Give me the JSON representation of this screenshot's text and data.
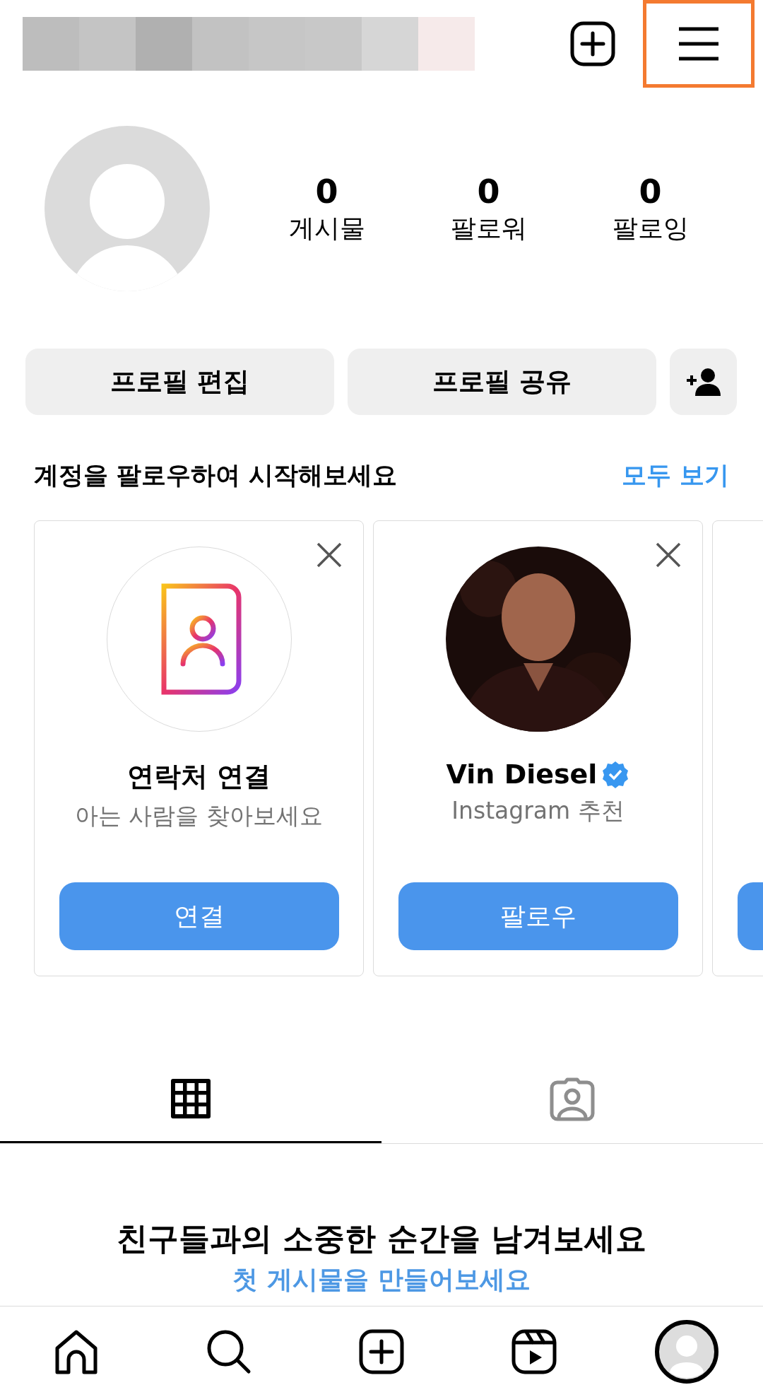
{
  "header": {
    "menu_highlighted": true
  },
  "stats": [
    {
      "value": "0",
      "label": "게시물"
    },
    {
      "value": "0",
      "label": "팔로워"
    },
    {
      "value": "0",
      "label": "팔로잉"
    }
  ],
  "actions": [
    "프로필 편집",
    "프로필 공유"
  ],
  "suggestions": {
    "title": "계정을 팔로우하여 시작해보세요",
    "see_all": "모두 보기",
    "cards": [
      {
        "kind": "contacts",
        "title": "연락처 연결",
        "subtitle": "아는 사람을 찾아보세요",
        "button": "연결",
        "verified": false
      },
      {
        "kind": "account",
        "title": "Vin Diesel",
        "subtitle": "Instagram 추천",
        "button": "팔로우",
        "verified": true
      },
      {
        "kind": "partial"
      }
    ]
  },
  "tabs": [
    {
      "kind": "grid",
      "selected": true
    },
    {
      "kind": "tagged",
      "selected": false
    }
  ],
  "empty": {
    "title": "친구들과의 소중한 순간을 남겨보세요",
    "link": "첫 게시물을 만들어보세요"
  },
  "nav": [
    {
      "kind": "home",
      "selected": false
    },
    {
      "kind": "search",
      "selected": false
    },
    {
      "kind": "create",
      "selected": false
    },
    {
      "kind": "reels",
      "selected": false
    },
    {
      "kind": "profile",
      "selected": true
    }
  ]
}
